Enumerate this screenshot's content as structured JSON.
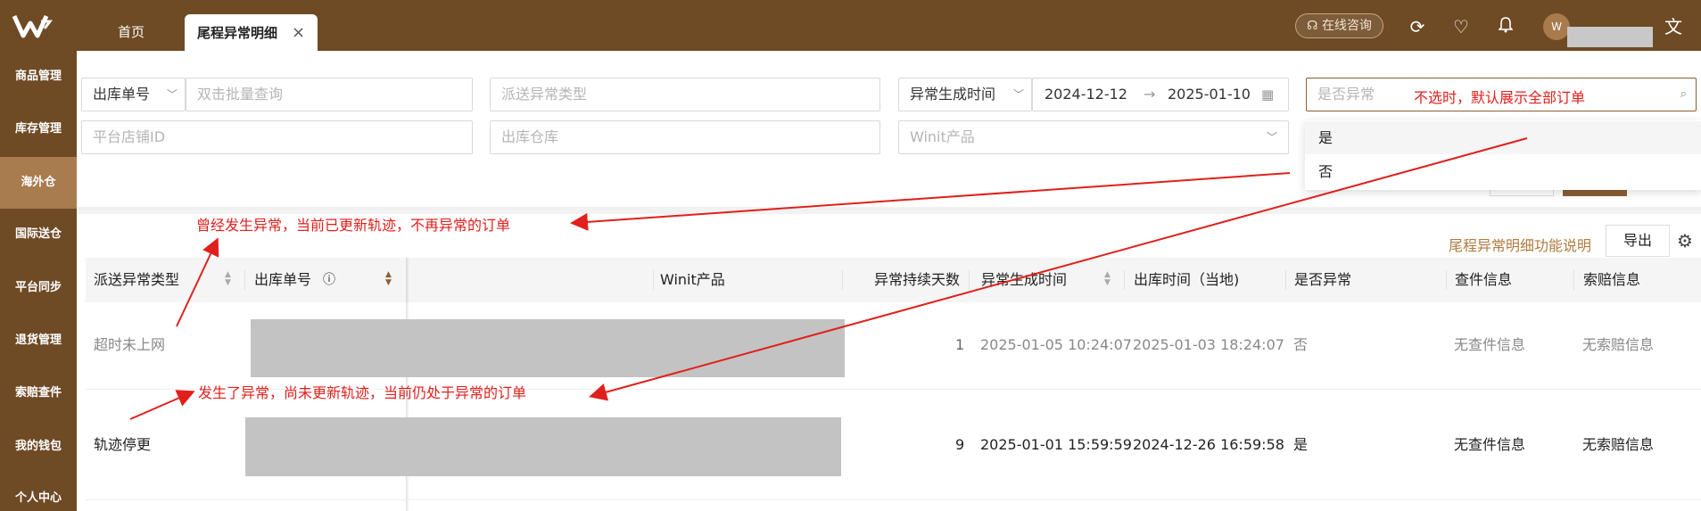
{
  "header": {
    "tabs": [
      {
        "label": "首页"
      },
      {
        "label": "尾程异常明细",
        "close": "×"
      }
    ],
    "online_consult": "在线咨询",
    "logo_text": "W"
  },
  "sidebar": {
    "items": [
      {
        "label": "商品管理"
      },
      {
        "label": "库存管理"
      },
      {
        "label": "海外仓",
        "active": true
      },
      {
        "label": "国际送仓"
      },
      {
        "label": "平台同步"
      },
      {
        "label": "退货管理"
      },
      {
        "label": "索赔查件"
      },
      {
        "label": "我的钱包"
      },
      {
        "label": "个人中心"
      }
    ]
  },
  "filters": {
    "order_type_select": "出库单号",
    "batch_query_placeholder": "双击批量查询",
    "exception_type_placeholder": "派送异常类型",
    "time_type_select": "异常生成时间",
    "date_start": "2024-12-12",
    "date_end": "2025-01-10",
    "is_exception_placeholder": "是否异常",
    "store_id_placeholder": "平台店铺ID",
    "warehouse_placeholder": "出库仓库",
    "winit_product_placeholder": "Winit产品",
    "dropdown_options": [
      "是",
      "否"
    ]
  },
  "toolbar": {
    "help_link": "尾程异常明细功能说明",
    "export_label": "导出"
  },
  "table": {
    "columns": [
      "派送异常类型",
      "出库单号",
      "Winit产品",
      "异常持续天数",
      "异常生成时间",
      "出库时间（当地)",
      "是否异常",
      "查件信息",
      "索赔信息"
    ],
    "rows": [
      {
        "type": "超时未上网",
        "days": "1",
        "created": "2025-01-05 10:24:07",
        "outbound": "2025-01-03 18:24:07",
        "is_exception": "否",
        "inquiry": "无查件信息",
        "claim": "无索赔信息"
      },
      {
        "type": "轨迹停更",
        "days": "9",
        "created": "2025-01-01 15:59:59",
        "outbound": "2024-12-26 16:59:58",
        "is_exception": "是",
        "inquiry": "无查件信息",
        "claim": "无索赔信息"
      }
    ]
  },
  "annotations": {
    "default_note": "不选时，默认展示全部订单",
    "past_note": "曾经发生异常，当前已更新轨迹，不再异常的订单",
    "current_note": "发生了异常，尚未更新轨迹，当前仍处于异常的订单"
  },
  "colors": {
    "brand_brown": "#6e4a25",
    "active_brown": "#a97c4f",
    "annotation_red": "#e0201c",
    "link_gold": "#b17b3f"
  }
}
